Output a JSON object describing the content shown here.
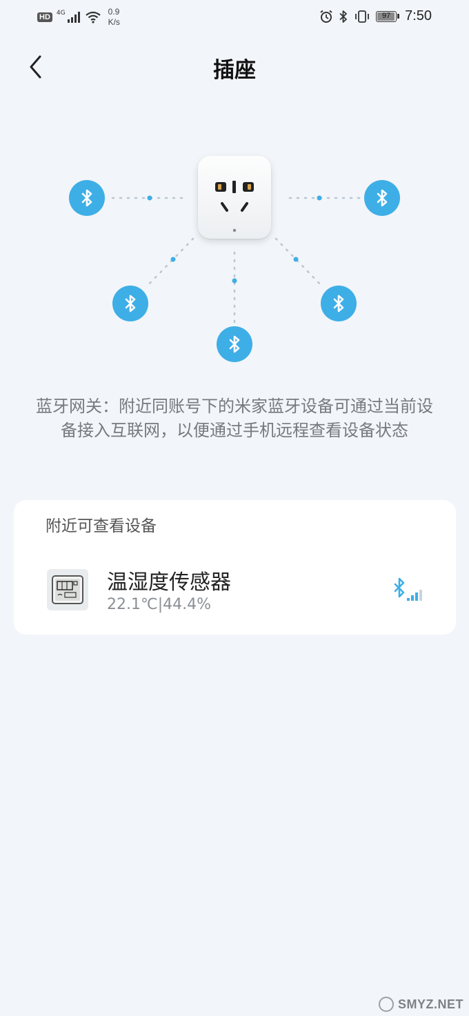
{
  "status_bar": {
    "hd_label": "HD",
    "network_gen": "4G",
    "speed_value": "0.9",
    "speed_unit": "K/s",
    "battery_level": "97",
    "time": "7:50",
    "icons": [
      "signal-icon",
      "wifi-icon",
      "alarm-icon",
      "bluetooth-icon",
      "vibrate-icon",
      "battery-icon"
    ]
  },
  "header": {
    "title": "插座",
    "back_icon": "chevron-left-icon"
  },
  "illustration": {
    "center_device": "smart-plug",
    "bluetooth_node_count": 5,
    "accent_color": "#3eaee6"
  },
  "description": "蓝牙网关：附近同账号下的米家蓝牙设备可通过当前设备接入互联网，以便通过手机远程查看设备状态",
  "nearby": {
    "title": "附近可查看设备",
    "devices": [
      {
        "name": "温湿度传感器",
        "status": "22.1℃|44.4%",
        "icon": "thermo-hygrometer-icon",
        "signal_icon": "bluetooth-signal-icon"
      }
    ]
  },
  "colors": {
    "background": "#f2f5f9",
    "card": "#ffffff",
    "bluetooth": "#3eaee6"
  },
  "watermark": "SMYZ.NET"
}
